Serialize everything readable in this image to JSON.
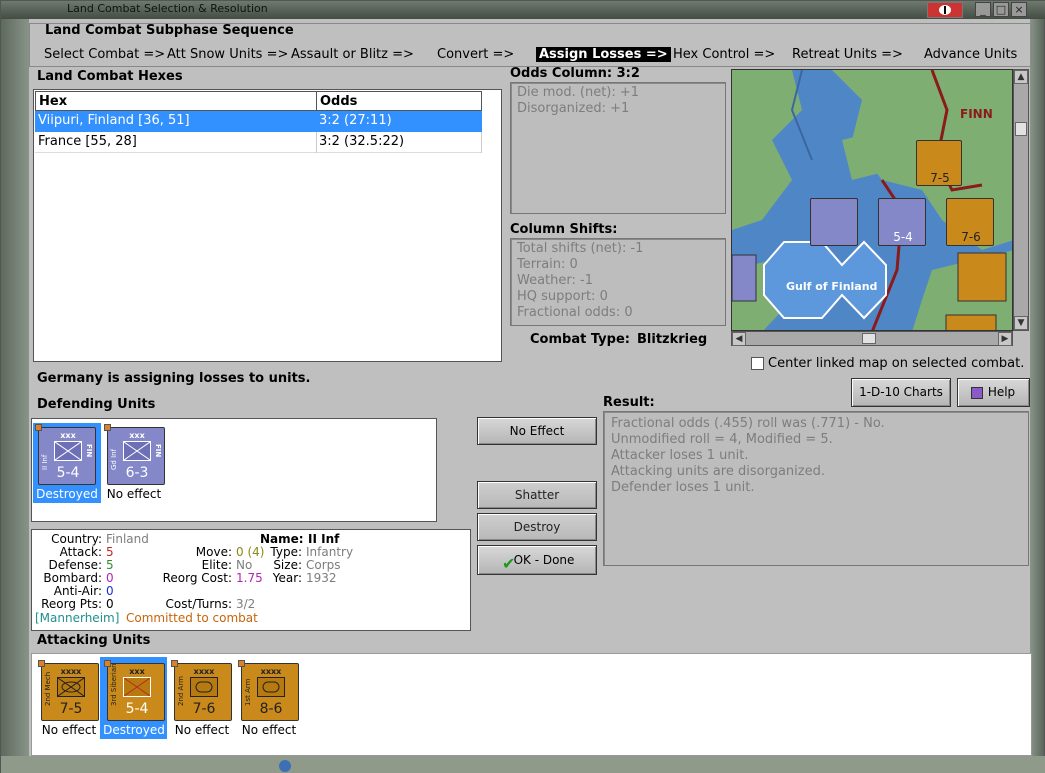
{
  "window": {
    "title": "Land Combat Selection & Resolution"
  },
  "phase": {
    "title": "Land Combat Subphase Sequence",
    "steps": [
      "Select Combat =>",
      "Att Snow Units =>",
      "Assault or Blitz =>",
      "Convert =>",
      "Assign Losses =>",
      "Hex Control =>",
      "Retreat Units =>",
      "Advance Units"
    ],
    "active_index": 4
  },
  "hexes": {
    "title": "Land Combat Hexes",
    "columns": [
      "Hex",
      "Odds"
    ],
    "rows": [
      {
        "hex": "Viipuri, Finland [36, 51]",
        "odds": "3:2 (27:11)"
      },
      {
        "hex": "France [55, 28]",
        "odds": "3:2 (32.5:22)"
      }
    ],
    "selected_index": 0
  },
  "odds": {
    "title": "Odds Column: 3:2",
    "lines": [
      "Die mod. (net): +1",
      "Disorganized: +1"
    ]
  },
  "shifts": {
    "title": "Column Shifts:",
    "lines": [
      "Total shifts (net): -1",
      "Terrain: 0",
      "Weather: -1",
      "HQ support: 0",
      "Fractional odds: 0"
    ]
  },
  "combat_type": {
    "label": "Combat Type:",
    "value": "Blitzkrieg"
  },
  "map": {
    "sea_label": "Gulf of Finland",
    "region_label": "FINN",
    "colors": {
      "sea": "#4f86c6",
      "land": "#7fae73",
      "axis": "#8487c8",
      "allied": "#c98a1b",
      "border": "#8b1a1a"
    }
  },
  "center_map": {
    "label": "Center linked map on selected combat.",
    "checked": false
  },
  "status": "Germany is assigning losses to units.",
  "buttons": {
    "charts": "1-D-10 Charts",
    "help": "Help",
    "no_effect": "No Effect",
    "shatter": "Shatter",
    "destroy": "Destroy",
    "ok_done": "OK - Done"
  },
  "defending": {
    "title": "Defending Units",
    "units": [
      {
        "name": "II Inf",
        "size": "xxx",
        "nat": "FIN",
        "value": "5-4",
        "status": "Destroyed",
        "selected": true
      },
      {
        "name": "Gd Inf",
        "size": "xxx",
        "nat": "FIN",
        "value": "6-3",
        "status": "No effect",
        "selected": false
      }
    ]
  },
  "result": {
    "title": "Result:",
    "lines": [
      "Fractional odds (.455) roll was (.771)  - No.",
      "Unmodified roll = 4, Modified = 5.",
      "Attacker loses 1 unit.",
      "Attacking units are disorganized.",
      "Defender loses 1 unit."
    ]
  },
  "unit_info": {
    "country_label": "Country:",
    "country": "Finland",
    "attack_label": "Attack:",
    "attack": "5",
    "defense_label": "Defense:",
    "defense": "5",
    "bombard_label": "Bombard:",
    "bombard": "0",
    "antiair_label": "Anti-Air:",
    "antiair": "0",
    "reorg_pts_label": "Reorg Pts:",
    "reorg_pts": "0",
    "name_label": "Name:",
    "name": "II Inf",
    "move_label": "Move:",
    "move": "0 (4)",
    "elite_label": "Elite:",
    "elite": "No",
    "reorg_cost_label": "Reorg Cost:",
    "reorg_cost": "1.75",
    "cost_turns_label": "Cost/Turns:",
    "cost_turns": "3/2",
    "type_label": "Type:",
    "type": "Infantry",
    "size_label": "Size:",
    "size": "Corps",
    "year_label": "Year:",
    "year": "1932",
    "hq": "[Mannerheim]",
    "committed": "Committed to combat"
  },
  "attacking": {
    "title": "Attacking Units",
    "units": [
      {
        "name": "2nd Mech",
        "size": "xxxx",
        "value": "7-5",
        "status": "No effect",
        "selected": false,
        "sym": "mech"
      },
      {
        "name": "3rd Siberian",
        "size": "xxx",
        "value": "5-4",
        "status": "Destroyed",
        "selected": true,
        "sym": "inf"
      },
      {
        "name": "2nd Arm",
        "size": "xxxx",
        "value": "7-6",
        "status": "No effect",
        "selected": false,
        "sym": "arm"
      },
      {
        "name": "1st Arm",
        "size": "xxxx",
        "value": "8-6",
        "status": "No effect",
        "selected": false,
        "sym": "arm"
      }
    ]
  }
}
